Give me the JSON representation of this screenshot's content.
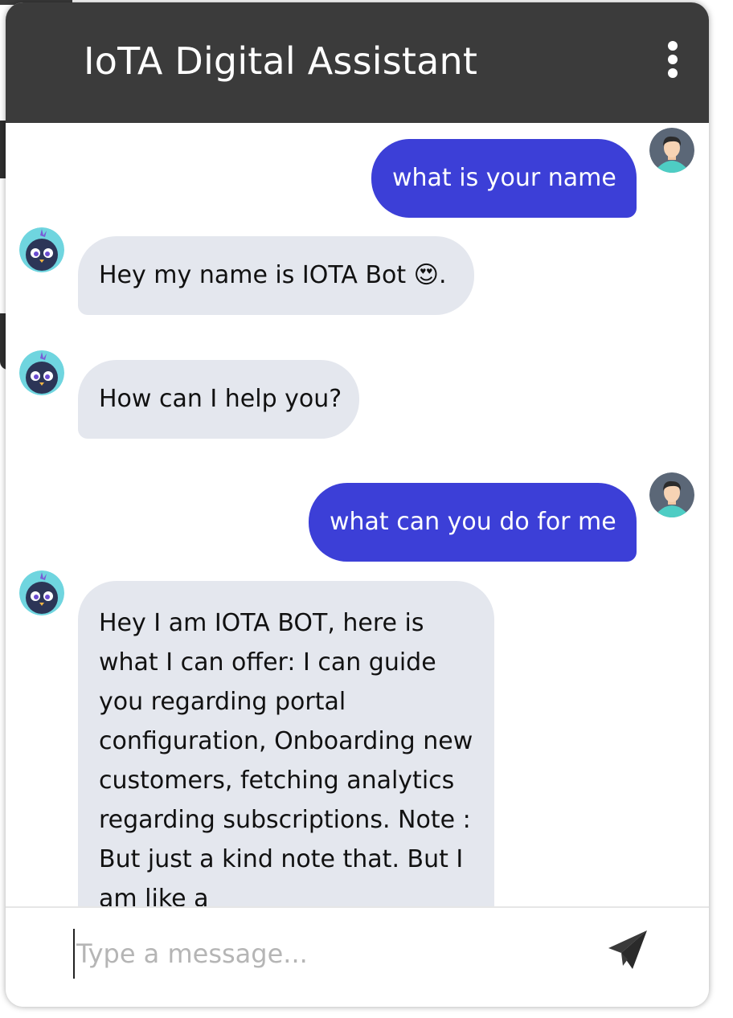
{
  "header": {
    "title": "IoTA Digital Assistant",
    "menu_icon": "kebab-menu-icon"
  },
  "messages": [
    {
      "from": "user",
      "text": "what is your name"
    },
    {
      "from": "bot",
      "text": "Hey my name is IOTA Bot 😍."
    },
    {
      "from": "bot",
      "text": "How can I help you?"
    },
    {
      "from": "user",
      "text": "what can you do for me"
    },
    {
      "from": "bot",
      "text": "Hey I am IOTA BOT, here is what I can offer: I can guide you regarding portal configuration, Onboarding new customers, fetching analytics regarding subscriptions. Note : But just a kind note that. But I am like a"
    }
  ],
  "composer": {
    "placeholder": "Type a message...",
    "send_icon": "send-icon"
  },
  "colors": {
    "header_bg": "#3b3b3b",
    "user_bubble": "#3c3fd7",
    "bot_bubble": "#e4e7ee"
  }
}
